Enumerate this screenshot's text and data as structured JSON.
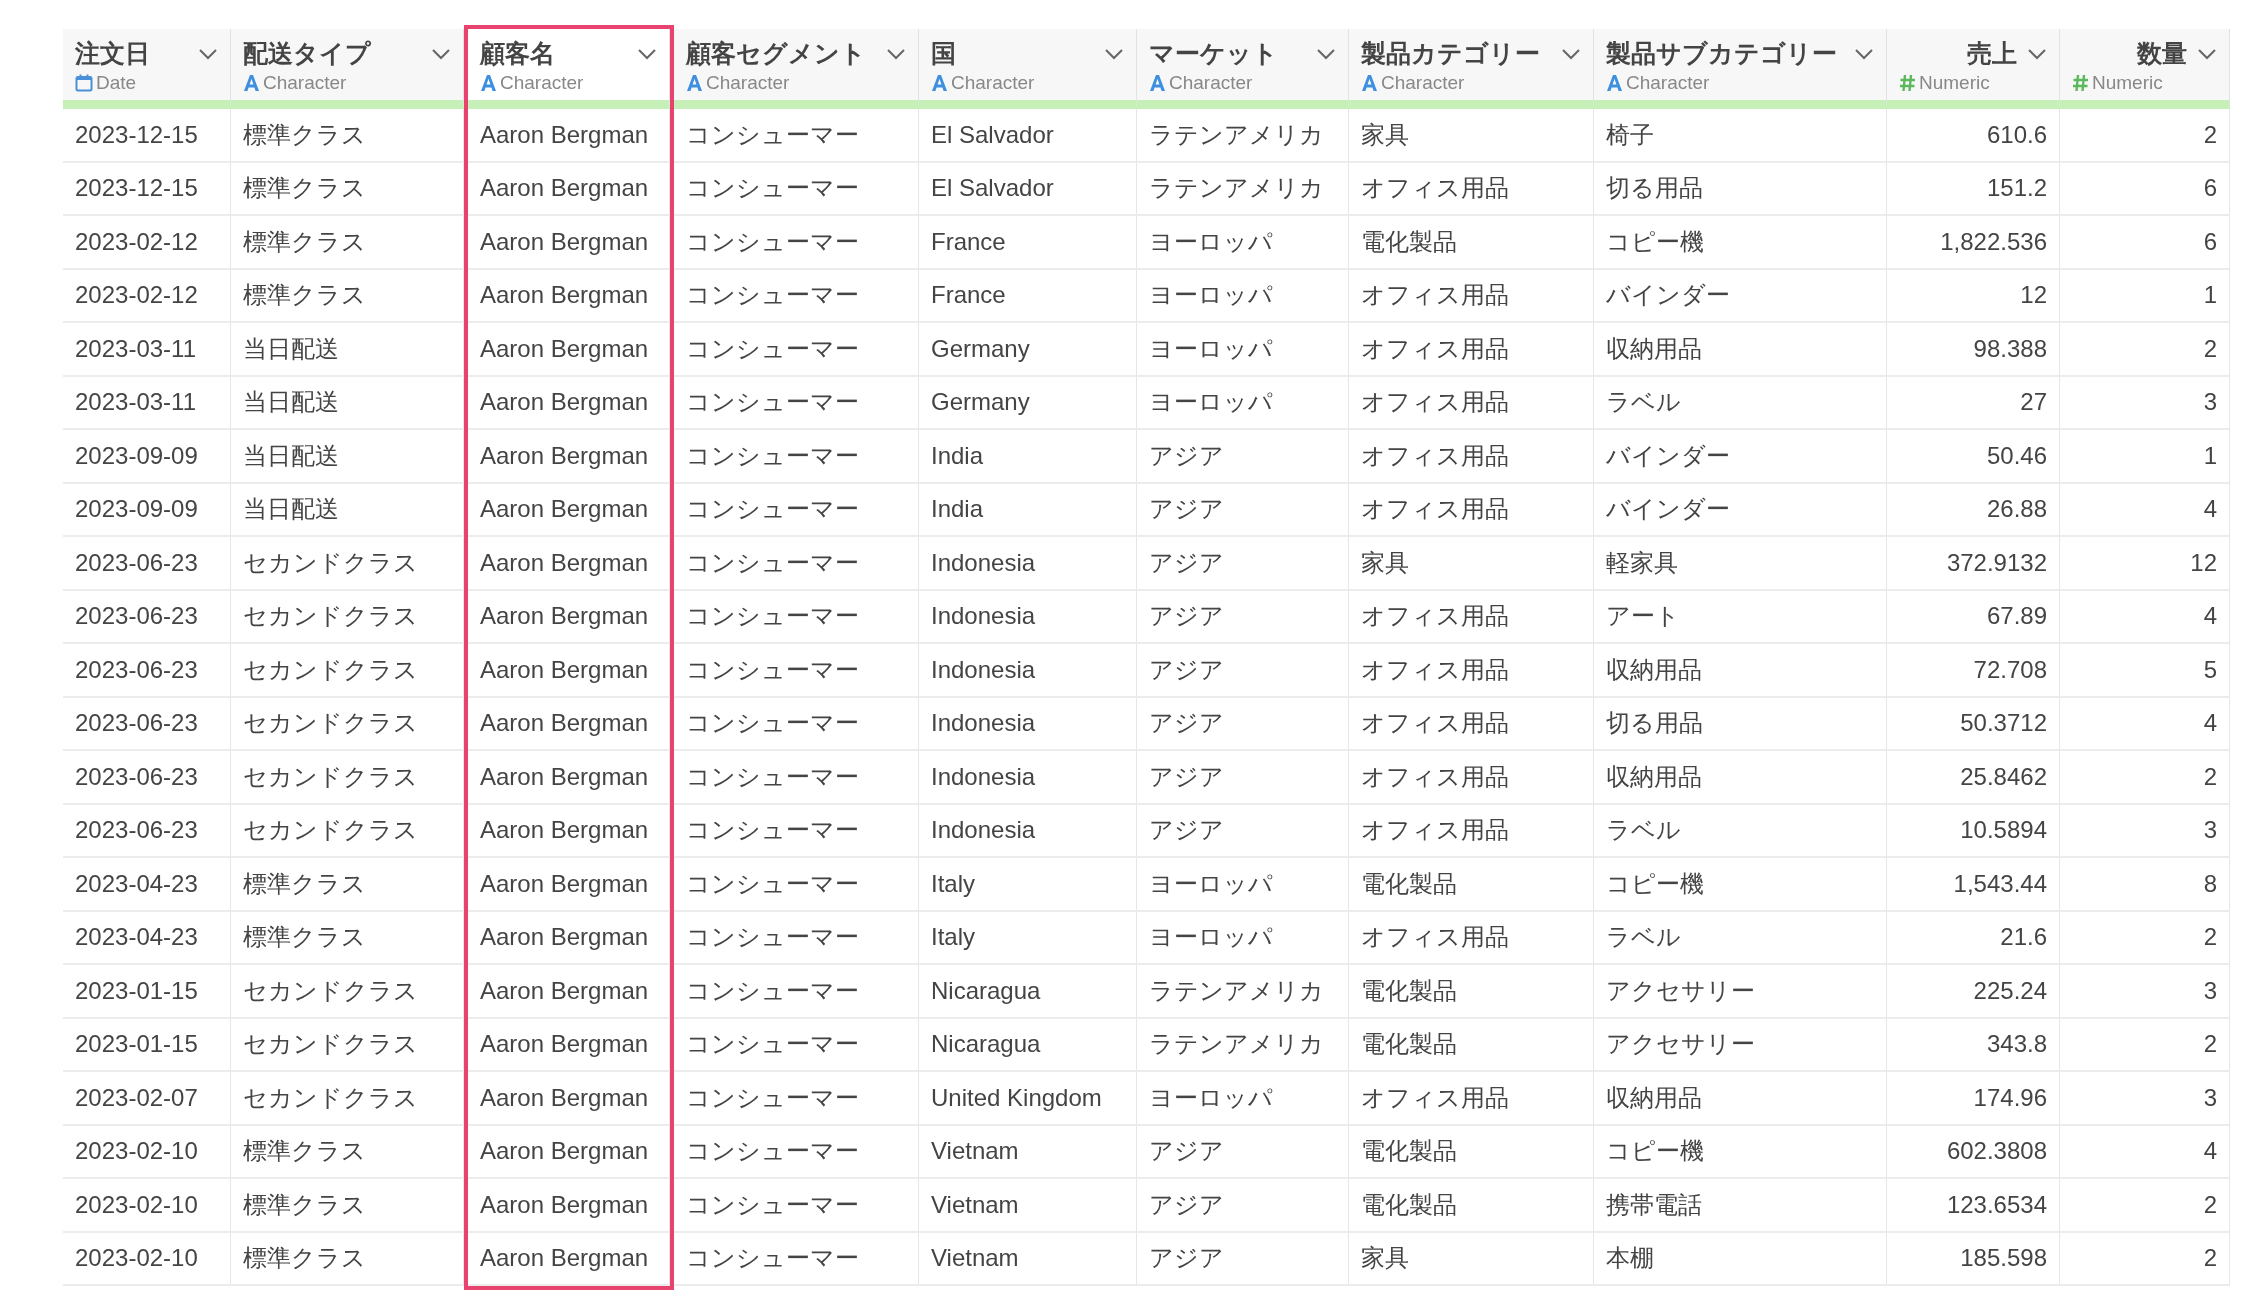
{
  "columns": [
    {
      "title": "注文日",
      "type": "Date",
      "kind": "date",
      "selected": false
    },
    {
      "title": "配送タイプ",
      "type": "Character",
      "kind": "character",
      "selected": false
    },
    {
      "title": "顧客名",
      "type": "Character",
      "kind": "character",
      "selected": true
    },
    {
      "title": "顧客セグメント",
      "type": "Character",
      "kind": "character",
      "selected": false
    },
    {
      "title": "国",
      "type": "Character",
      "kind": "character",
      "selected": false
    },
    {
      "title": "マーケット",
      "type": "Character",
      "kind": "character",
      "selected": false
    },
    {
      "title": "製品カテゴリー",
      "type": "Character",
      "kind": "character",
      "selected": false
    },
    {
      "title": "製品サブカテゴリー",
      "type": "Character",
      "kind": "character",
      "selected": false
    },
    {
      "title": "売上",
      "type": "Numeric",
      "kind": "numeric",
      "selected": false
    },
    {
      "title": "数量",
      "type": "Numeric",
      "kind": "numeric",
      "selected": false
    }
  ],
  "rows": [
    [
      "2023-12-15",
      "標準クラス",
      "Aaron Bergman",
      "コンシューマー",
      "El Salvador",
      "ラテンアメリカ",
      "家具",
      "椅子",
      "610.6",
      "2"
    ],
    [
      "2023-12-15",
      "標準クラス",
      "Aaron Bergman",
      "コンシューマー",
      "El Salvador",
      "ラテンアメリカ",
      "オフィス用品",
      "切る用品",
      "151.2",
      "6"
    ],
    [
      "2023-02-12",
      "標準クラス",
      "Aaron Bergman",
      "コンシューマー",
      "France",
      "ヨーロッパ",
      "電化製品",
      "コピー機",
      "1,822.536",
      "6"
    ],
    [
      "2023-02-12",
      "標準クラス",
      "Aaron Bergman",
      "コンシューマー",
      "France",
      "ヨーロッパ",
      "オフィス用品",
      "バインダー",
      "12",
      "1"
    ],
    [
      "2023-03-11",
      "当日配送",
      "Aaron Bergman",
      "コンシューマー",
      "Germany",
      "ヨーロッパ",
      "オフィス用品",
      "収納用品",
      "98.388",
      "2"
    ],
    [
      "2023-03-11",
      "当日配送",
      "Aaron Bergman",
      "コンシューマー",
      "Germany",
      "ヨーロッパ",
      "オフィス用品",
      "ラベル",
      "27",
      "3"
    ],
    [
      "2023-09-09",
      "当日配送",
      "Aaron Bergman",
      "コンシューマー",
      "India",
      "アジア",
      "オフィス用品",
      "バインダー",
      "50.46",
      "1"
    ],
    [
      "2023-09-09",
      "当日配送",
      "Aaron Bergman",
      "コンシューマー",
      "India",
      "アジア",
      "オフィス用品",
      "バインダー",
      "26.88",
      "4"
    ],
    [
      "2023-06-23",
      "セカンドクラス",
      "Aaron Bergman",
      "コンシューマー",
      "Indonesia",
      "アジア",
      "家具",
      "軽家具",
      "372.9132",
      "12"
    ],
    [
      "2023-06-23",
      "セカンドクラス",
      "Aaron Bergman",
      "コンシューマー",
      "Indonesia",
      "アジア",
      "オフィス用品",
      "アート",
      "67.89",
      "4"
    ],
    [
      "2023-06-23",
      "セカンドクラス",
      "Aaron Bergman",
      "コンシューマー",
      "Indonesia",
      "アジア",
      "オフィス用品",
      "収納用品",
      "72.708",
      "5"
    ],
    [
      "2023-06-23",
      "セカンドクラス",
      "Aaron Bergman",
      "コンシューマー",
      "Indonesia",
      "アジア",
      "オフィス用品",
      "切る用品",
      "50.3712",
      "4"
    ],
    [
      "2023-06-23",
      "セカンドクラス",
      "Aaron Bergman",
      "コンシューマー",
      "Indonesia",
      "アジア",
      "オフィス用品",
      "収納用品",
      "25.8462",
      "2"
    ],
    [
      "2023-06-23",
      "セカンドクラス",
      "Aaron Bergman",
      "コンシューマー",
      "Indonesia",
      "アジア",
      "オフィス用品",
      "ラベル",
      "10.5894",
      "3"
    ],
    [
      "2023-04-23",
      "標準クラス",
      "Aaron Bergman",
      "コンシューマー",
      "Italy",
      "ヨーロッパ",
      "電化製品",
      "コピー機",
      "1,543.44",
      "8"
    ],
    [
      "2023-04-23",
      "標準クラス",
      "Aaron Bergman",
      "コンシューマー",
      "Italy",
      "ヨーロッパ",
      "オフィス用品",
      "ラベル",
      "21.6",
      "2"
    ],
    [
      "2023-01-15",
      "セカンドクラス",
      "Aaron Bergman",
      "コンシューマー",
      "Nicaragua",
      "ラテンアメリカ",
      "電化製品",
      "アクセサリー",
      "225.24",
      "3"
    ],
    [
      "2023-01-15",
      "セカンドクラス",
      "Aaron Bergman",
      "コンシューマー",
      "Nicaragua",
      "ラテンアメリカ",
      "電化製品",
      "アクセサリー",
      "343.8",
      "2"
    ],
    [
      "2023-02-07",
      "セカンドクラス",
      "Aaron Bergman",
      "コンシューマー",
      "United Kingdom",
      "ヨーロッパ",
      "オフィス用品",
      "収納用品",
      "174.96",
      "3"
    ],
    [
      "2023-02-10",
      "標準クラス",
      "Aaron Bergman",
      "コンシューマー",
      "Vietnam",
      "アジア",
      "電化製品",
      "コピー機",
      "602.3808",
      "4"
    ],
    [
      "2023-02-10",
      "標準クラス",
      "Aaron Bergman",
      "コンシューマー",
      "Vietnam",
      "アジア",
      "電化製品",
      "携帯電話",
      "123.6534",
      "2"
    ],
    [
      "2023-02-10",
      "標準クラス",
      "Aaron Bergman",
      "コンシューマー",
      "Vietnam",
      "アジア",
      "家具",
      "本棚",
      "185.598",
      "2"
    ]
  ]
}
